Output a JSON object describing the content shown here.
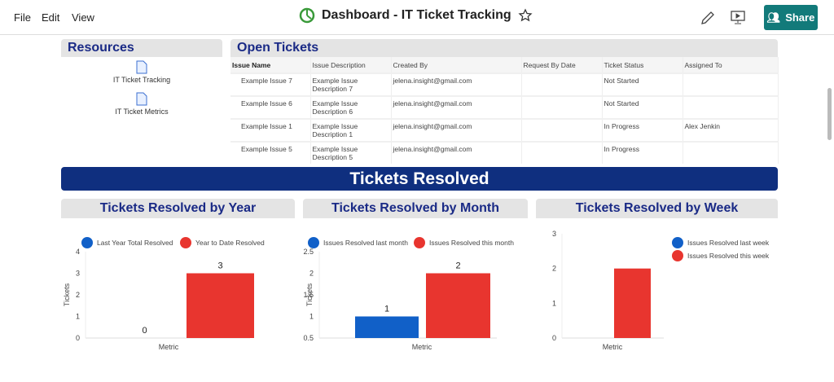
{
  "menu": [
    "File",
    "Edit",
    "View"
  ],
  "title": "Dashboard - IT Ticket Tracking",
  "share_label": "Share",
  "colors": {
    "accent": "#127a7a",
    "navy": "#0f2f7f",
    "blue": "#1160c8",
    "red": "#e8352f"
  },
  "resources": {
    "title": "Resources",
    "items": [
      "IT Ticket Tracking",
      "IT Ticket Metrics"
    ]
  },
  "open_tickets": {
    "title": "Open Tickets",
    "columns": [
      "Issue Name",
      "Issue Description",
      "Created By",
      "Request By Date",
      "Ticket Status",
      "Assigned To"
    ],
    "rows": [
      [
        "Example Issue 7",
        "Example Issue Description 7",
        "jelena.insight@gmail.com",
        "",
        "Not Started",
        ""
      ],
      [
        "Example Issue 6",
        "Example Issue Description 6",
        "jelena.insight@gmail.com",
        "",
        "Not Started",
        ""
      ],
      [
        "Example Issue 1",
        "Example Issue Description 1",
        "jelena.insight@gmail.com",
        "",
        "In Progress",
        "Alex Jenkin"
      ],
      [
        "Example Issue 5",
        "Example Issue Description 5",
        "jelena.insight@gmail.com",
        "",
        "In Progress",
        ""
      ]
    ]
  },
  "banner": "Tickets Resolved",
  "chart_data": [
    {
      "type": "bar",
      "title": "Tickets Resolved by Year",
      "xlabel": "Metric",
      "ylabel": "Tickets",
      "categories": [
        "Metric"
      ],
      "ylim": [
        0,
        4
      ],
      "ticks": [
        0,
        1,
        2,
        3,
        4
      ],
      "legend": "top",
      "series": [
        {
          "name": "Last Year Total Resolved",
          "values": [
            0
          ],
          "color": "#1160c8",
          "label": "0"
        },
        {
          "name": "Year to Date Resolved",
          "values": [
            3
          ],
          "color": "#e8352f",
          "label": "3"
        }
      ]
    },
    {
      "type": "bar",
      "title": "Tickets Resolved by Month",
      "xlabel": "Metric",
      "ylabel": "Tickets",
      "categories": [
        "Metric"
      ],
      "ylim": [
        0.5,
        2.5
      ],
      "ticks": [
        0.5,
        1,
        1.5,
        2,
        2.5
      ],
      "legend": "top",
      "series": [
        {
          "name": "Issues Resolved last month",
          "values": [
            1
          ],
          "color": "#1160c8",
          "label": "1"
        },
        {
          "name": "Issues Resolved this month",
          "values": [
            2
          ],
          "color": "#e8352f",
          "label": "2"
        }
      ]
    },
    {
      "type": "bar",
      "title": "Tickets Resolved by Week",
      "xlabel": "Metric",
      "ylabel": "",
      "categories": [
        "Metric"
      ],
      "ylim": [
        0,
        3
      ],
      "ticks": [
        0,
        1,
        2,
        3
      ],
      "legend": "right",
      "series": [
        {
          "name": "Issues Resolved last week",
          "values": [
            0
          ],
          "color": "#1160c8",
          "label": ""
        },
        {
          "name": "Issues Resolved this week",
          "values": [
            2
          ],
          "color": "#e8352f",
          "label": ""
        }
      ]
    }
  ]
}
